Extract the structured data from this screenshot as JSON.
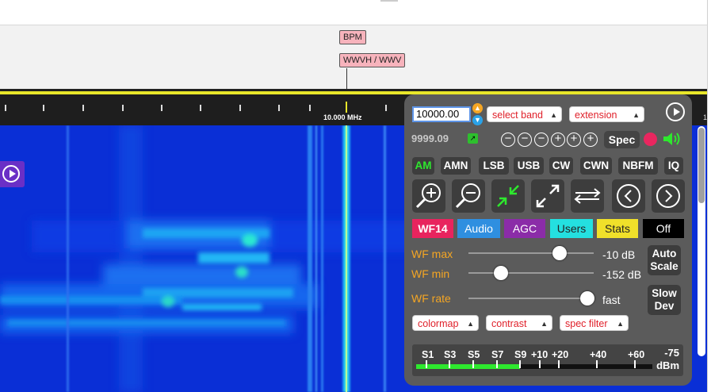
{
  "stations": {
    "bpm": "BPM",
    "wwv": "WWVH / WWV"
  },
  "scale": {
    "center_label": "10.000 MHz",
    "right_label": "1"
  },
  "panel": {
    "frequency_value": "10000.00",
    "frequency_sub": "9999.09",
    "band_select": "select band",
    "extension_select": "extension",
    "spec_label": "Spec",
    "modes": [
      "AM",
      "AMN",
      "LSB",
      "USB",
      "CW",
      "CWN",
      "NBFM",
      "IQ"
    ],
    "active_mode": "AM",
    "tabs": [
      {
        "label": "WF14",
        "bg": "#e8245e",
        "fg": "#ffffff"
      },
      {
        "label": "Audio",
        "bg": "#2f8fe0",
        "fg": "#ffffff"
      },
      {
        "label": "AGC",
        "bg": "#8b2ca8",
        "fg": "#ffffff"
      },
      {
        "label": "Users",
        "bg": "#24e0e0",
        "fg": "#222222"
      },
      {
        "label": "Stats",
        "bg": "#f0e02a",
        "fg": "#222222"
      },
      {
        "label": "Off",
        "bg": "#000000",
        "fg": "#ffffff"
      }
    ],
    "wf_max": {
      "label": "WF max",
      "value": "-10 dB",
      "level": 0.73
    },
    "wf_min": {
      "label": "WF min",
      "value": "-152 dB",
      "level": 0.26
    },
    "wf_rate": {
      "label": "WF rate",
      "value": "fast",
      "level": 0.95
    },
    "auto_scale": {
      "line1": "Auto",
      "line2": "Scale"
    },
    "slow_dev": {
      "line1": "Slow",
      "line2": "Dev"
    },
    "colormap": "colormap",
    "contrast": "contrast",
    "spec_filter": "spec filter",
    "smeter": {
      "marks": [
        "S1",
        "S3",
        "S5",
        "S7",
        "S9",
        "+10",
        "+20",
        "+40",
        "+60"
      ],
      "dbm_value": "-75",
      "dbm_unit": "dBm",
      "fill_fraction": 0.44
    }
  },
  "colors": {
    "accent_orange": "#f5a623",
    "mode_active": "#2ee82e",
    "marker_yellow": "#e8e62a"
  }
}
